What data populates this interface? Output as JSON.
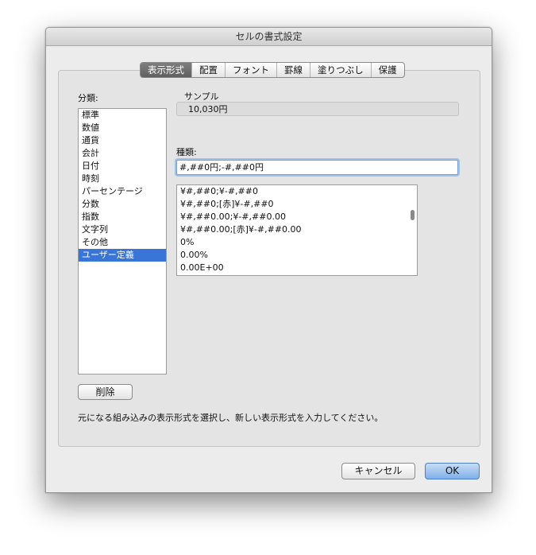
{
  "window": {
    "title": "セルの書式設定"
  },
  "tabs": [
    {
      "label": "表示形式",
      "active": true
    },
    {
      "label": "配置"
    },
    {
      "label": "フォント"
    },
    {
      "label": "罫線"
    },
    {
      "label": "塗りつぶし"
    },
    {
      "label": "保護"
    }
  ],
  "category": {
    "label": "分類:",
    "items": [
      "標準",
      "数値",
      "通貨",
      "会計",
      "日付",
      "時刻",
      "パーセンテージ",
      "分数",
      "指数",
      "文字列",
      "その他",
      "ユーザー定義"
    ],
    "selected": "ユーザー定義"
  },
  "sample": {
    "label": "サンプル",
    "value": "10,030円"
  },
  "type": {
    "label": "種類:",
    "value": "#,##0円;-#,##0円",
    "formats": [
      "¥#,##0;¥-#,##0",
      "¥#,##0;[赤]¥-#,##0",
      "¥#,##0.00;¥-#,##0.00",
      "¥#,##0.00;[赤]¥-#,##0.00",
      "0%",
      "0.00%",
      "0.00E+00"
    ]
  },
  "delete_button": "削除",
  "hint": "元になる組み込みの表示形式を選択し、新しい表示形式を入力してください。",
  "cancel_button": "キャンセル",
  "ok_button": "OK",
  "colors": {
    "selection": "#3875d7",
    "default_button": "#7fb0ea"
  }
}
